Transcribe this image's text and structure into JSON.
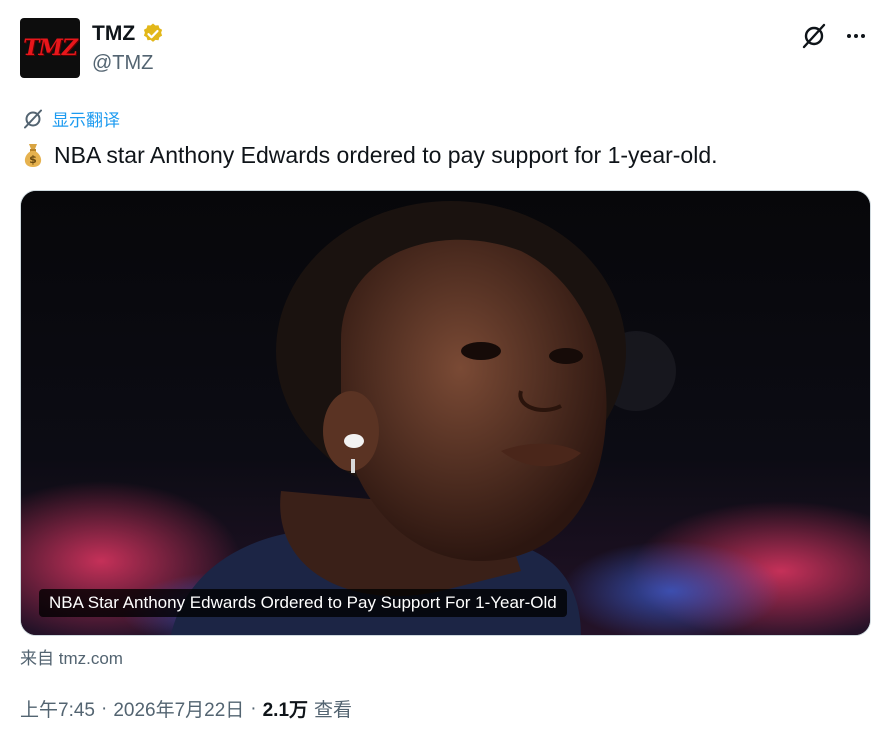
{
  "header": {
    "avatar_logo": "TMZ",
    "display_name": "TMZ",
    "handle": "@TMZ",
    "verified_color": "#e2b719"
  },
  "actions": {
    "grok_icon": "grok-icon",
    "more_icon": "more-icon"
  },
  "translate": {
    "label": "显示翻译"
  },
  "tweet": {
    "emoji_icon": "money-bag-icon",
    "text": "NBA star Anthony Edwards ordered to pay support for 1-year-old."
  },
  "card": {
    "caption": "NBA Star Anthony Edwards Ordered to Pay Support For 1-Year-Old",
    "source": "来自 tmz.com"
  },
  "meta": {
    "time": "上午7:45",
    "sep1": "·",
    "date": "2026年7月22日",
    "sep2": "·",
    "views": "2.1万",
    "views_label": "查看"
  },
  "colors": {
    "link": "#1d9bf0",
    "secondary_text": "#536471",
    "primary_text": "#0f1419"
  }
}
